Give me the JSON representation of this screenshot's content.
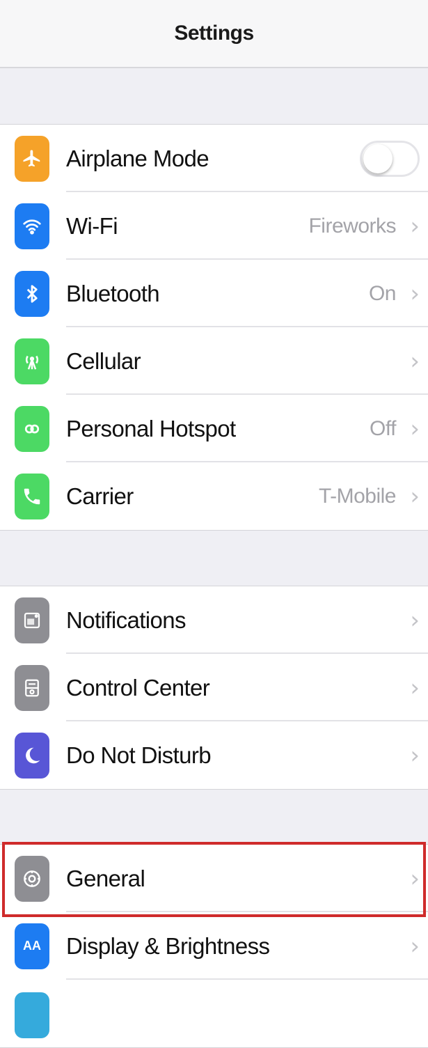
{
  "navbar": {
    "title": "Settings"
  },
  "groups": [
    {
      "items": [
        {
          "label": "Airplane Mode",
          "icon": "airplane-icon",
          "color": "#f5a229",
          "control": "toggle",
          "toggle_on": false
        },
        {
          "label": "Wi-Fi",
          "icon": "wifi-icon",
          "color": "#1d7cf2",
          "value": "Fireworks"
        },
        {
          "label": "Bluetooth",
          "icon": "bluetooth-icon",
          "color": "#1d7cf2",
          "value": "On"
        },
        {
          "label": "Cellular",
          "icon": "cellular-icon",
          "color": "#4cd964",
          "value": ""
        },
        {
          "label": "Personal Hotspot",
          "icon": "hotspot-icon",
          "color": "#4cd964",
          "value": "Off"
        },
        {
          "label": "Carrier",
          "icon": "phone-icon",
          "color": "#4cd964",
          "value": "T-Mobile"
        }
      ]
    },
    {
      "items": [
        {
          "label": "Notifications",
          "icon": "notifications-icon",
          "color": "#8e8e93"
        },
        {
          "label": "Control Center",
          "icon": "control-center-icon",
          "color": "#8e8e93"
        },
        {
          "label": "Do Not Disturb",
          "icon": "moon-icon",
          "color": "#5856d6"
        }
      ]
    },
    {
      "items": [
        {
          "label": "General",
          "icon": "gear-icon",
          "color": "#8e8e93",
          "highlighted": true
        },
        {
          "label": "Display & Brightness",
          "icon": "display-brightness-icon",
          "color": "#1d7cf2",
          "icon_text": "AA"
        },
        {
          "label": "",
          "icon": "wallpaper-icon",
          "color": "#35aadc"
        }
      ]
    }
  ],
  "highlight_color": "#cf2b2b"
}
